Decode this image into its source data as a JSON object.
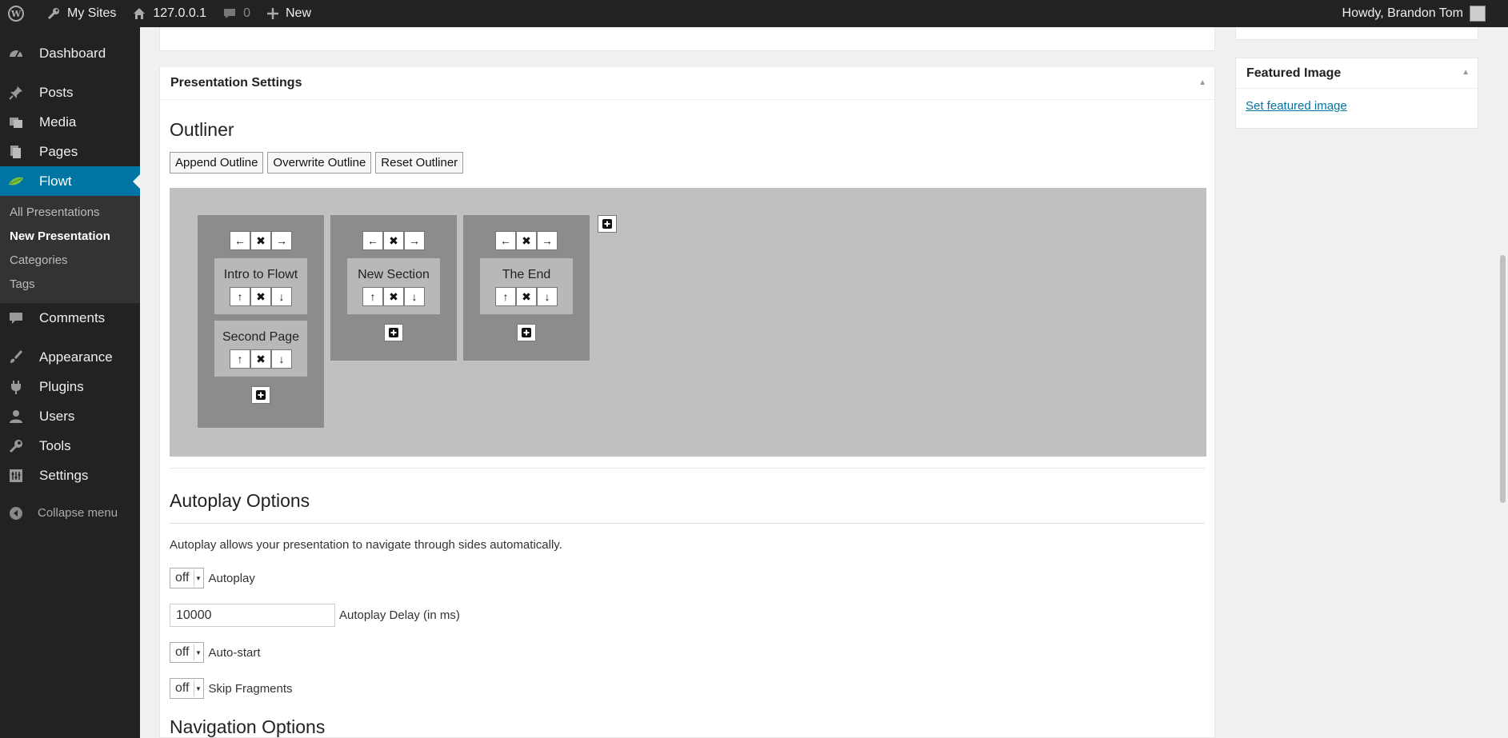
{
  "adminbar": {
    "my_sites": "My Sites",
    "site_name": "127.0.0.1",
    "comments_count": "0",
    "new_label": "New",
    "howdy": "Howdy, Brandon Tom"
  },
  "sidebar": {
    "items": [
      {
        "label": "Dashboard",
        "icon": "dashboard-icon"
      },
      {
        "label": "Posts",
        "icon": "pin-icon"
      },
      {
        "label": "Media",
        "icon": "media-icon"
      },
      {
        "label": "Pages",
        "icon": "pages-icon"
      },
      {
        "label": "Flowt",
        "icon": "leaf-icon"
      },
      {
        "label": "Comments",
        "icon": "comment-icon"
      },
      {
        "label": "Appearance",
        "icon": "brush-icon"
      },
      {
        "label": "Plugins",
        "icon": "plug-icon"
      },
      {
        "label": "Users",
        "icon": "user-icon"
      },
      {
        "label": "Tools",
        "icon": "wrench-icon"
      },
      {
        "label": "Settings",
        "icon": "settings-icon"
      }
    ],
    "submenu": [
      "All Presentations",
      "New Presentation",
      "Categories",
      "Tags"
    ],
    "collapse": "Collapse menu"
  },
  "presentation": {
    "box_title": "Presentation Settings",
    "outliner_title": "Outliner",
    "buttons": [
      "Append Outline",
      "Overwrite Outline",
      "Reset Outliner"
    ],
    "sections": [
      {
        "pages": [
          "Intro to Flowt",
          "Second Page"
        ]
      },
      {
        "pages": [
          "New Section"
        ]
      },
      {
        "pages": [
          "The End"
        ]
      }
    ]
  },
  "autoplay": {
    "title": "Autoplay Options",
    "description": "Autoplay allows your presentation to navigate through sides automatically.",
    "autoplay_value": "off",
    "autoplay_label": "Autoplay",
    "delay_value": "10000",
    "delay_label": "Autoplay Delay (in ms)",
    "autostart_value": "off",
    "autostart_label": "Auto-start",
    "skip_value": "off",
    "skip_label": "Skip Fragments"
  },
  "navigation": {
    "title": "Navigation Options"
  },
  "featured": {
    "title": "Featured Image",
    "link": "Set featured image"
  }
}
